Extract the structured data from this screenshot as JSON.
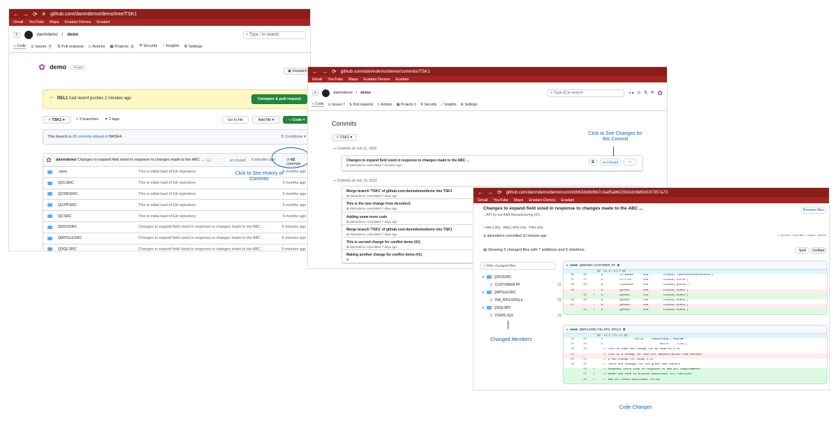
{
  "shot1": {
    "url": "github.com/danmdemo/demo/tree/TSK1",
    "bookmarks": [
      "Gmail",
      "YouTube",
      "Maps",
      "Eradani Demos",
      "Eradani"
    ],
    "owner": "danmdemo",
    "repo": "demo",
    "search_placeholder": "Type / to search",
    "tabs": [
      "Code",
      "Issues",
      "7",
      "Pull requests",
      "Actions",
      "Projects",
      "1",
      "Security",
      "Insights",
      "Settings"
    ],
    "repo_name": "demo",
    "visibility": "Private",
    "unwatch": "Unwatch",
    "push_branch": "REL1",
    "push_text": "had recent pushes 2 minutes ago",
    "compare_btn": "Compare & pull request",
    "branch": "TSK1",
    "branches": "5 branches",
    "tags": "2 tags",
    "goto_file": "Go to file",
    "add_file": "Add file",
    "code_btn": "Code",
    "ahead_text": "This branch is",
    "ahead_link": "26 commits ahead of",
    "ahead_base": "BASE4.",
    "contribute": "Contribute",
    "commit_author": "danmdemo",
    "commit_msg": "Changes to expand field sized in response to changes made to the ABC ...",
    "commit_hash": "eccbaa6",
    "commit_time": "5 minutes ago",
    "commits_count": "62",
    "commits_label": "commits",
    "files": [
      {
        "name": ".iseni",
        "msg": "This is initial load of Git repository",
        "time": "5 months ago"
      },
      {
        "name": "QCLSRC",
        "msg": "This is initial load of Git repository",
        "time": "5 months ago"
      },
      {
        "name": "QCMDSRC",
        "msg": "This is initial load of Git repository",
        "time": "5 months ago"
      },
      {
        "name": "QCPPSRC",
        "msg": "This is initial load of Git repository",
        "time": "5 months ago"
      },
      {
        "name": "QCSRC",
        "msg": "This is initial load of Git repository",
        "time": "5 months ago"
      },
      {
        "name": "QDDSSRC",
        "msg": "Changes to expand field sized in response to changes made to the ABC ...",
        "time": "5 minutes ago"
      },
      {
        "name": "QRPGLESRC",
        "msg": "Changes to expand field sized in response to changes made to the ABC ...",
        "time": "5 minutes ago"
      },
      {
        "name": "QSQLSRC",
        "msg": "Changes to expand field sized in response to changes made to the ABC ...",
        "time": "5 minutes ago"
      }
    ],
    "annotation": "Click to See History of Commits"
  },
  "shot2": {
    "url": "github.com/danmdemo/demo/commits/TSK1",
    "owner": "danmdemo",
    "repo": "demo",
    "search_placeholder": "Type [/] to search",
    "heading": "Commits",
    "branch": "TSK1",
    "date1": "Commits on Jun 11, 2023",
    "date2": "Commits on Jun 10, 2023",
    "commits": [
      {
        "title": "Changes to expand field sized in response to changes made to the ABC ...",
        "meta": "danmdemo committed 7 minutes ago"
      },
      {
        "title": "Merge branch 'TSK1' of github.com:danmdemo/demo into TSK1",
        "meta": "danmdemo committed 7 days ago"
      },
      {
        "title": "This is the new change from devodev2",
        "meta": "danmdemo committed 7 days ago"
      },
      {
        "title": "Adding some more code",
        "meta": "danmdemo committed 7 days ago"
      },
      {
        "title": "Merge branch 'TSK1' of github.com:danmdemo/demo into TSK1",
        "meta": "danmdemo committed 7 days ago"
      },
      {
        "title": "This is second change for conflict demo (#1)",
        "meta": "danmdemo committed 7 days ago"
      },
      {
        "title": "Making another change for conflict demo (#1)",
        "meta": ""
      }
    ],
    "hash": "eccbaa6",
    "annotation": "Click to See Changes for this Commit"
  },
  "shot3": {
    "url": "github.com/danmdemo/demo/commit/b62dddbf6b7c3ad5a86229d1dcbb60d167357a73",
    "title": "Changes to expand field sized in response to changes made to the ABC ...",
    "subtitle": "...API by our AAA Manufacturing (#1)",
    "browse": "Browse files",
    "branches_line": "REL1 (#1) · REL1, INT1 (#1) · TSK1 (#1)",
    "author_line": "danmdemo committed 10 minutes ago",
    "parent_line": "1 parent 3ae788b  commit b62dd",
    "summary": "Showing 3 changed files with 7 additions and 5 deletions.",
    "split": "Split",
    "unified": "Unified",
    "filter_placeholder": "Filter changed files",
    "tree": [
      {
        "name": "QDDSSRC",
        "type": "folder"
      },
      {
        "name": "CUSTOMER.PF",
        "type": "file"
      },
      {
        "name": "QRPGLESRC",
        "type": "folder"
      },
      {
        "name": "HW_RPG.RPGLE",
        "type": "file"
      },
      {
        "name": "QSQLSRC",
        "type": "folder"
      },
      {
        "name": "ITEMS.SQL",
        "type": "file"
      }
    ],
    "file1": "QDDSSRC/CUSTOMER.PF",
    "file2": "QRPGLESRC/HW_RPG.RPGLE",
    "hunk1": "@@ -34,8 +34,8 @@",
    "hunk2": "@@ -21,5 +21,11 @@",
    "diff1": [
      {
        "o": "36",
        "n": "36",
        "t": "     A          CCTAXNUM      50A         COLHDG('TaxExternalReference')",
        "k": ""
      },
      {
        "o": "37",
        "n": "37",
        "t": "     A          CCTITLE       50A         COLHDG('title')",
        "k": ""
      },
      {
        "o": "38",
        "n": "38",
        "t": "     A          CCADDR03      50A         COLHDG('postal')",
        "k": ""
      },
      {
        "o": "39",
        "n": "",
        "t": "-    A          QD0401        20A         COLHDG('DEMO1')",
        "k": "del"
      },
      {
        "o": "",
        "n": "39",
        "t": "+    A          QD0401        25A         COLHDG('DEMO1')",
        "k": "add"
      },
      {
        "o": "40",
        "n": "40",
        "t": "     A          QD0402        20A         COLHDG('DEMO2')",
        "k": ""
      },
      {
        "o": "41",
        "n": "",
        "t": "-    A          QD0403        20A         COLHDG('DEMO3')",
        "k": "del"
      },
      {
        "o": "",
        "n": "41",
        "t": "+    A          QD0403        25A         COLHDG('DEMO3')",
        "k": "add"
      }
    ],
    "diff2": [
      {
        "o": "21",
        "n": "21",
        "t": "     C                   callp     SendExcMsg ('MsDEBB':",
        "k": ""
      },
      {
        "o": "22",
        "n": "22",
        "t": "     C                                 'Hello' : '*LIB')",
        "k": ""
      },
      {
        "o": "23",
        "n": "23",
        "t": "      // This is some new change for my demo on 6-14",
        "k": ""
      },
      {
        "o": "24",
        "n": "",
        "t": "-     // This is a change for conflict demonstration from devdev2",
        "k": "del"
      },
      {
        "o": "25",
        "n": "24",
        "t": "      // A new change for today 3-15",
        "k": ""
      },
      {
        "o": "26",
        "n": "25",
        "t": "      // There are changes for the great new feature",
        "k": ""
      },
      {
        "o": "",
        "n": "26",
        "t": "+     // Expanded field size in response to new API requirements",
        "k": "add"
      },
      {
        "o": "",
        "n": "27",
        "t": "+     // Added new code to provide additional API functions",
        "k": "add"
      },
      {
        "o": "",
        "n": "28",
        "t": "+     // New API needs additional fields",
        "k": "add"
      }
    ],
    "annot_members": "Changed Members",
    "annot_code": "Code Changes"
  },
  "colors": {
    "chrome": "#8b1e1b",
    "bookmarks": "#a62420",
    "annotation": "#0a5fbf",
    "green": "#1f883d",
    "add": "#dafbe1",
    "del": "#ffebe9"
  }
}
